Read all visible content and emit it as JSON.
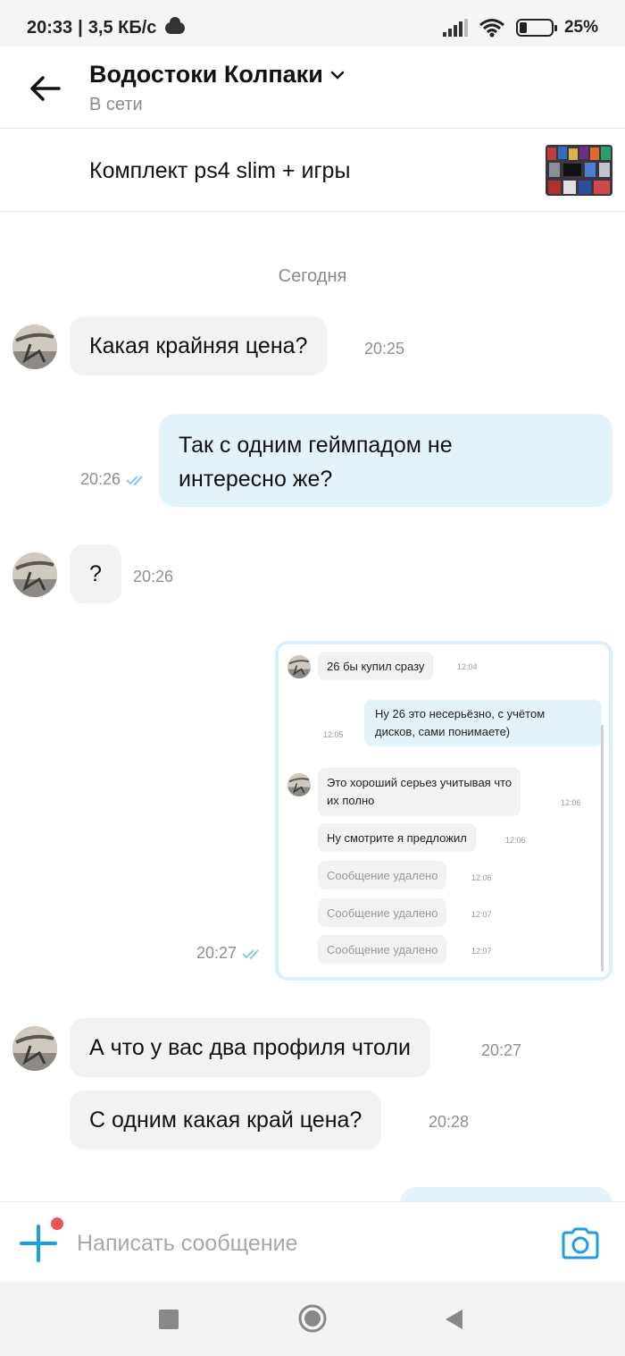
{
  "status_bar": {
    "time": "20:33",
    "speed": "3,5 КБ/с",
    "battery": "25%",
    "battery_level": 0.25,
    "icons": [
      "cloud-icon",
      "signal-icon",
      "wifi-icon",
      "battery-icon"
    ]
  },
  "header": {
    "title": "Водостоки Колпаки",
    "status": "В сети"
  },
  "listing": {
    "title": "Комплект ps4 slim + игры"
  },
  "chat": {
    "day_label": "Сегодня",
    "messages": [
      {
        "text": "Какая крайняя цена?",
        "time": "20:25"
      },
      {
        "text_line1": "Так с одним геймпадом не",
        "text_line2": "интересно же?",
        "time": "20:26"
      },
      {
        "text": "?",
        "time": "20:26"
      },
      {
        "time": "20:27"
      },
      {
        "text": "А что у вас два профиля чтоли",
        "time": "20:27"
      },
      {
        "text": "С одним какая край цена?",
        "time": "20:28"
      }
    ],
    "screenshot": {
      "m1": {
        "text": "26 бы купил сразу",
        "time": "12:04"
      },
      "m2": {
        "line1": "Ну 26 это несерьёзно, с учётом",
        "line2": "дисков, сами понимаете)",
        "time": "12:05"
      },
      "m3": {
        "line1": "Это хороший серьез учитывая что",
        "line2": "их полно",
        "time": "12:06"
      },
      "m4": {
        "text": "Ну смотрите я предложил",
        "time": "12:06"
      },
      "m5": {
        "text": "Сообщение удалено",
        "time": "12:06"
      },
      "m6": {
        "text": "Сообщение удалено",
        "time": "12:07"
      },
      "m7": {
        "text": "Сообщение удалено",
        "time": "12:07"
      }
    }
  },
  "composer": {
    "placeholder": "Написать сообщение"
  },
  "colors": {
    "accent": "#1c9ee6",
    "outgoing_bubble": "#e3f3fc",
    "incoming_bubble": "#f2f2f2",
    "notification_dot": "#f0545a"
  }
}
